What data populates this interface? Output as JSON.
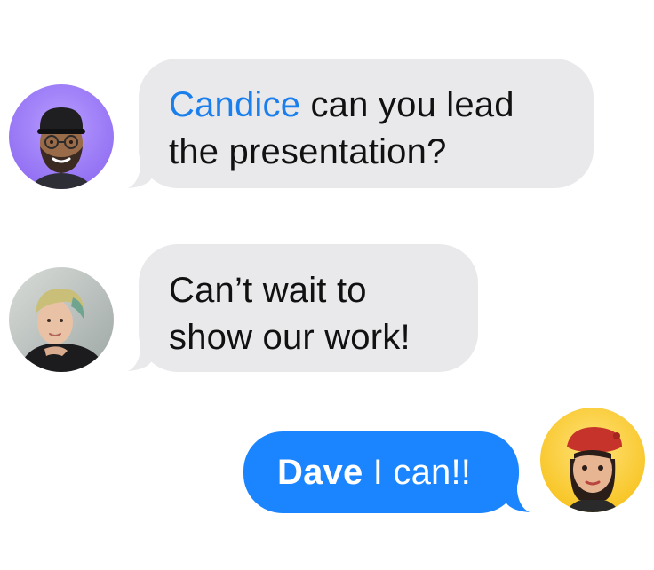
{
  "colors": {
    "incoming_bubble": "#e9e9eb",
    "outgoing_bubble": "#1a85ff",
    "mention_incoming": "#1a7fec",
    "text_dark": "#111111",
    "text_light": "#ffffff"
  },
  "messages": [
    {
      "direction": "incoming",
      "avatar": "memoji-man-avatar",
      "mention": "Candice",
      "line1_rest": " can you lead",
      "line2": "the presentation?"
    },
    {
      "direction": "incoming",
      "avatar": "photo-woman-avatar",
      "line1": "Can’t wait to",
      "line2": "show our work!"
    },
    {
      "direction": "outgoing",
      "avatar": "memoji-woman-avatar",
      "mention": "Dave",
      "rest": " I can!!"
    }
  ]
}
